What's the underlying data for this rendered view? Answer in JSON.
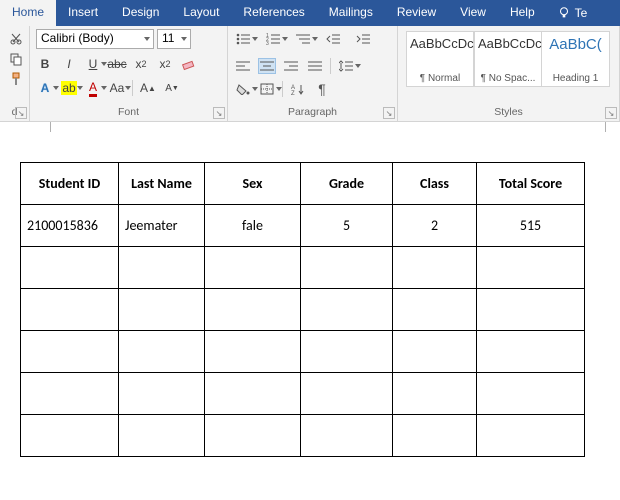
{
  "tabs": [
    "Home",
    "Insert",
    "Design",
    "Layout",
    "References",
    "Mailings",
    "Review",
    "View",
    "Help"
  ],
  "active_tab": "Home",
  "tell_me": "Te",
  "font": {
    "name": "Calibri (Body)",
    "size": "11",
    "group_label": "Font"
  },
  "paragraph": {
    "group_label": "Paragraph"
  },
  "styles": {
    "group_label": "Styles",
    "preview_text": "AaBbCcDc",
    "preview_text_h1": "AaBbC(",
    "items": [
      {
        "name": "¶ Normal"
      },
      {
        "name": "¶ No Spac..."
      },
      {
        "name": "Heading 1"
      }
    ]
  },
  "table": {
    "headers": [
      "Student ID",
      "Last Name",
      "Sex",
      "Grade",
      "Class",
      "Total Score"
    ],
    "rows": [
      [
        "2100015836",
        "Jeemater",
        "fale",
        "5",
        "2",
        "515"
      ],
      [
        "",
        "",
        "",
        "",
        "",
        ""
      ],
      [
        "",
        "",
        "",
        "",
        "",
        ""
      ],
      [
        "",
        "",
        "",
        "",
        "",
        ""
      ],
      [
        "",
        "",
        "",
        "",
        "",
        ""
      ],
      [
        "",
        "",
        "",
        "",
        "",
        ""
      ]
    ]
  }
}
